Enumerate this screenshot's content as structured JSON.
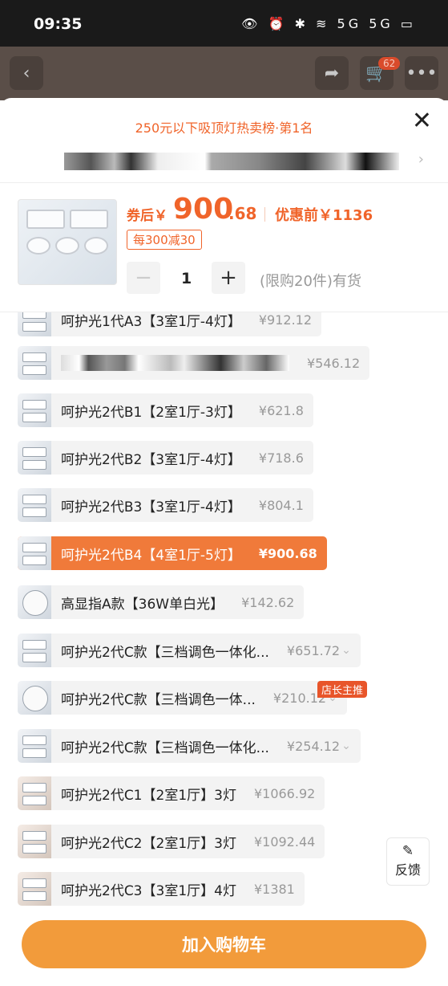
{
  "status_bar": {
    "time": "09:35",
    "icons": "👁 ⏰ ✱ ≋ 5G 5G ▭"
  },
  "top_bar": {
    "back_icon": "chevron-left-icon",
    "share_icon": "share-icon",
    "cart_icon": "cart-icon",
    "cart_count": "62",
    "more_icon": "more-icon"
  },
  "sheet": {
    "rank_title": "250元以下吸顶灯热卖榜·第1名",
    "close_label": "✕",
    "price_prefix": "券后￥",
    "price_int": "900",
    "price_dec": ".68",
    "price_before": "优惠前￥1136",
    "coupon": "每300减30",
    "qty_minus": "−",
    "qty": "1",
    "qty_plus": "+",
    "stock": "(限购20件)有货"
  },
  "variants": [
    {
      "name": "呵护光1代A3【3室1厅-4灯】",
      "price": "¥912.12"
    },
    {
      "name": "",
      "price": "¥546.12"
    },
    {
      "name": "呵护光2代B1【2室1厅-3灯】",
      "price": "¥621.8"
    },
    {
      "name": "呵护光2代B2【3室1厅-4灯】",
      "price": "¥718.6"
    },
    {
      "name": "呵护光2代B3【3室1厅-4灯】",
      "price": "¥804.1"
    },
    {
      "name": "呵护光2代B4【4室1厅-5灯】",
      "price": "¥900.68"
    },
    {
      "name": "高显指A款【36W单白光】",
      "price": "¥142.62"
    },
    {
      "name": "呵护光2代C款【三档调色一体化...",
      "price": "¥651.72"
    },
    {
      "name": "呵护光2代C款【三档调色一体...",
      "price": "¥210.12"
    },
    {
      "name": "呵护光2代C款【三档调色一体化...",
      "price": "¥254.12"
    },
    {
      "name": "呵护光2代C1【2室1厅】3灯",
      "price": "¥1066.92"
    },
    {
      "name": "呵护光2代C2【2室1厅】3灯",
      "price": "¥1092.44"
    },
    {
      "name": "呵护光2代C3【3室1厅】4灯",
      "price": "¥1381"
    }
  ],
  "shop_tag": "店长主推",
  "feedback": {
    "icon": "✎",
    "label": "反馈"
  },
  "add_to_cart": "加入购物车",
  "colors": {
    "accent": "#f0642a",
    "button": "#f29b3b",
    "selected": "#f07a3a"
  }
}
